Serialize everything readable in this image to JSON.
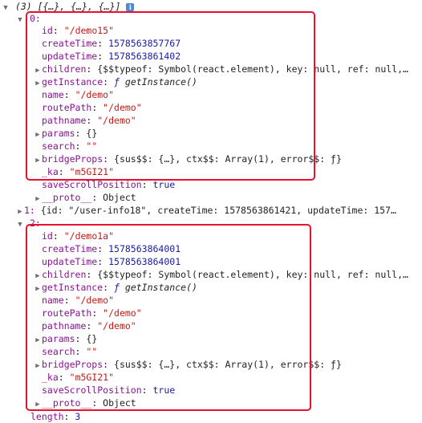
{
  "header": {
    "summary": "(3) [{…}, {…}, {…}]",
    "info_icon": "i"
  },
  "items": [
    {
      "index": "0:",
      "fields": {
        "id": "\"/demo15\"",
        "createTime": "1578563857767",
        "updateTime": "1578563861402",
        "children_summary": "{$$typeof: Symbol(react.element), key: null, ref: null,…",
        "getInstance": "getInstance()",
        "name": "\"/demo\"",
        "routePath": "\"/demo\"",
        "pathname": "\"/demo\"",
        "params": "{}",
        "search": "\"\"",
        "bridgeProps_summary": "{sus$$: {…}, ctx$$: Array(1), error$$: ƒ}",
        "_ka": "\"m5GI21\"",
        "saveScrollPosition": "true",
        "proto": "Object"
      }
    },
    {
      "index": "1:",
      "collapsed_summary": "{id: \"/user-info18\", createTime: 1578563861421, updateTime: 157…"
    },
    {
      "index": "2:",
      "fields": {
        "id": "\"/demo1a\"",
        "createTime": "1578563864001",
        "updateTime": "1578563864001",
        "children_summary": "{$$typeof: Symbol(react.element), key: null, ref: null,…",
        "getInstance": "getInstance()",
        "name": "\"/demo\"",
        "routePath": "\"/demo\"",
        "pathname": "\"/demo\"",
        "params": "{}",
        "search": "\"\"",
        "bridgeProps_summary": "{sus$$: {…}, ctx$$: Array(1), error$$: ƒ}",
        "_ka": "\"m5GI21\"",
        "saveScrollPosition": "true",
        "proto": "Object"
      }
    }
  ],
  "labels": {
    "id": "id",
    "createTime": "createTime",
    "updateTime": "updateTime",
    "children": "children",
    "getInstance": "getInstance",
    "name": "name",
    "routePath": "routePath",
    "pathname": "pathname",
    "params": "params",
    "search": "search",
    "bridgeProps": "bridgeProps",
    "_ka": "_ka",
    "saveScrollPosition": "saveScrollPosition",
    "proto": "__proto__",
    "length": "length",
    "f_glyph": "ƒ"
  },
  "footer": {
    "length_value": "3"
  },
  "colors": {
    "highlight": "#e8102c",
    "key": "#881391",
    "string": "#c41a16",
    "number": "#1a1aa6"
  }
}
